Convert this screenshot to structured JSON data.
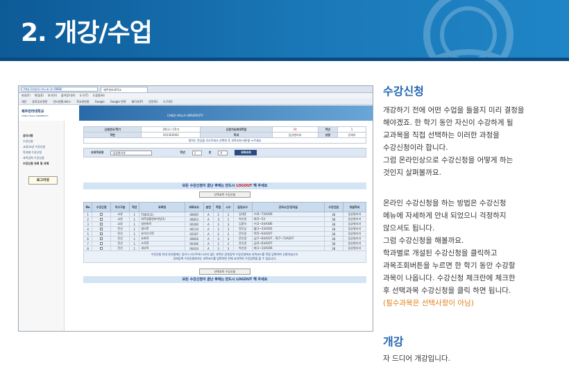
{
  "banner": {
    "title": "2. 개강/수업"
  },
  "browser": {
    "address": "http://stylar.chu.ac.kr:8888/",
    "tab_title": "제주한라대학교",
    "menu": [
      "파일(F)",
      "편집(E)",
      "보기(V)",
      "즐겨찾기(A)",
      "도구(T)",
      "도움말(H)"
    ],
    "favorites": [
      "개인",
      "동료공유관한",
      "인터넷홈서비스",
      "학교관한홈",
      "Google",
      "Google 번역",
      "페이지(P)",
      "안전(S)",
      "도구(O)"
    ]
  },
  "site": {
    "logo_text": "제주한라대학교",
    "logo_sub": "CHEJU HALLA UNIVERSITY",
    "head_text": "CHEJU HALLA UNIVERSITY",
    "sidebar": [
      "공지사항",
      "수강신청",
      "교양/교양 수강신청",
      "학과별 수강신청",
      "과목입력 수강신청",
      "수강신청 조회 및 삭제"
    ],
    "logout_label": "로그아웃"
  },
  "student_info": {
    "row1": [
      "신청년도/학기",
      "2013 / 1학기",
      "신청가능최대학점",
      "24",
      "학년",
      "1"
    ],
    "row2": [
      "학번",
      "201302002",
      "학과",
      "임상병리과",
      "성명",
      "강세리"
    ],
    "hint": "원하는 전공을 리스트에서 선택한 후 과목조회 버튼을 누르세요"
  },
  "search": {
    "dept_label": "조회학과명",
    "dept_value": "임상병리과",
    "grade_label": "학년",
    "grade_value": "1",
    "class_label": "반",
    "class_value": "A",
    "button": "과목조회"
  },
  "notice": {
    "before": "모든 수강신청이 끝난 후에는 반드시 ",
    "logout": "LOGOUT",
    "after": " 해 주세요"
  },
  "buttons": {
    "course_register": "선택과목 수강신청"
  },
  "table": {
    "headers": [
      "No",
      "수강신청",
      "이수구분",
      "학년",
      "과목명",
      "과목코드",
      "분반",
      "학점",
      "시수",
      "담당교수",
      "강의시간/강의실",
      "수강인원",
      "개설학과"
    ],
    "rows": [
      [
        "1",
        "",
        "교양",
        "1",
        "TOEIC(1)",
        "00695",
        "A",
        "2",
        "2",
        "김대준",
        "수(6~7)/A206",
        "38",
        "임상병리과"
      ],
      [
        "2",
        "",
        "교양",
        "1",
        "대학생활정파이팅(1)",
        "00853",
        "A",
        ".5",
        "1",
        "박신영",
        "화(5~5)/",
        "38",
        "임상병리과"
      ],
      [
        "3",
        "",
        "교양",
        "1",
        "일반화학",
        "00300",
        "A",
        "3",
        "3",
        "김정석",
        "수(2~4)/A306",
        "38",
        "임상병리과"
      ],
      [
        "4",
        "",
        "전선",
        "1",
        "병리학",
        "00110",
        "A",
        "3",
        "3",
        "정무상",
        "월(1~3)/A202",
        "38",
        "임상병리과"
      ],
      [
        "5",
        "",
        "전선",
        "1",
        "분석기기학",
        "02267",
        "A",
        "2",
        "2",
        "문인경",
        "목(5~6)/A207",
        "38",
        "임상병리과"
      ],
      [
        "6",
        "",
        "전선",
        "1",
        "요화학",
        "00856",
        "A",
        "3",
        "3",
        "문인경",
        "금(7~8)/A207 , 목(7~7)/A207",
        "38",
        "임상병리과"
      ],
      [
        "7",
        "",
        "전선",
        "1",
        "조직학",
        "00366",
        "A",
        "2",
        "2",
        "문인경",
        "금(5~6)/A207",
        "38",
        "임상병리과"
      ],
      [
        "8",
        "",
        "전선",
        "1",
        "세부학",
        "00424",
        "A",
        "3",
        "3",
        "박신영",
        "화(1~3)/A206",
        "38",
        "임상병리과"
      ]
    ],
    "guide1": "수강신청 안내 유인물에는 있으나 리스트에 나오지 않는 과목은 강좌입력 수강신청에서 과목코드를 직접 입력하여 신청하십시오.",
    "guide2": "강좌입력 수강신청에서는 과목코드를 입력하면 전체 교과목의 수강입력을 할 수 있습니다."
  },
  "section1": {
    "title": "수강신청",
    "para1": [
      "개강하기 전에 어떤 수업을 들을지 미리 결정을",
      "해야겠죠. 한 학기 동안 자신이 수강하게 될",
      "교과목을 직접 선택하는 이러한 과정을",
      "수강신청이라 합니다.",
      "그럼 온라인상으로 수강신청을 어떻게 하는",
      "것인지 살펴볼까요."
    ],
    "para2": [
      "온라인 수강신청을 하는 방법은 수강신청",
      "메뉴에 자세하게 안내 되었으니 걱정하지",
      "않으셔도 됩니다.",
      "그럼 수강신청을 해볼까요.",
      "학과별로 개설된 수강신청을 클릭하고",
      "과목조회버튼을 누르면 한 학기 동안 수강할",
      "과목이 나옵니다. 수강신청 체크란에 체크한",
      "후 선택과목 수강신청을 클릭 하면 됩니다."
    ],
    "note": "(필수과목은 선택사항이 아님)"
  },
  "section2": {
    "title": "개강",
    "text": "자 드디어 개강입니다."
  }
}
